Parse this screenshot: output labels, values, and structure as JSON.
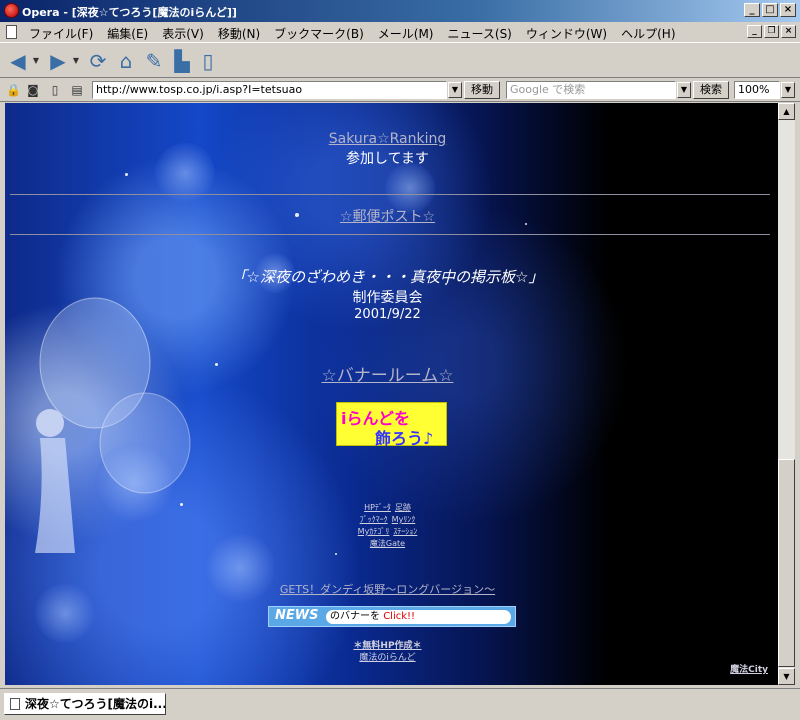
{
  "window": {
    "title": "Opera - [深夜☆てつろう[魔法のiらんど]]"
  },
  "menu": {
    "items": [
      "ファイル(F)",
      "編集(E)",
      "表示(V)",
      "移動(N)",
      "ブックマーク(B)",
      "メール(M)",
      "ニュース(S)",
      "ウィンドウ(W)",
      "ヘルプ(H)"
    ]
  },
  "address": {
    "url": "http://www.tosp.co.jp/i.asp?I=tetsuao",
    "go_label": "移動",
    "search_placeholder": "Google で検索",
    "search_label": "検索",
    "zoom": "100%"
  },
  "page": {
    "top_cut_text": "\"\"\"\"\"\"\"\"\"",
    "sakura_link": "Sakura☆Ranking",
    "sakura_sub": "参加してます",
    "post_link": "☆郵便ポスト☆",
    "board_title": "「☆深夜のざわめき・・・真夜中の掲示板☆」",
    "board_sub": "制作委員会",
    "board_date": "2001/9/22",
    "banner_room_link": "☆バナールーム☆",
    "iland_banner": {
      "line1": "iらんどを",
      "line2": "飾ろう♪"
    },
    "small_links": [
      [
        "HPﾃﾞｰﾀ",
        "足跡"
      ],
      [
        "ﾌﾞｯｸﾏｰｸ",
        "Myﾘﾝｸ"
      ],
      [
        "Myｶﾃｺﾞﾘ",
        "ｽﾃｰｼｮﾝ"
      ],
      [
        "魔法Gate"
      ]
    ],
    "gets_link": "GETS！ダンディ坂野～ロングバージョン～",
    "news": {
      "label": "NEWS",
      "text": "のバナーを ",
      "click": "Click!!"
    },
    "free_hp": "＊無料HP作成＊",
    "maho_iland": "魔法のiらんど",
    "maho_city": "魔法City"
  },
  "status": {
    "tab_title": "深夜☆てつろう[魔法のi..."
  },
  "colors": {
    "titlebar": "#0a246a",
    "chrome": "#d4d0c8",
    "link": "#b4b4c8"
  }
}
